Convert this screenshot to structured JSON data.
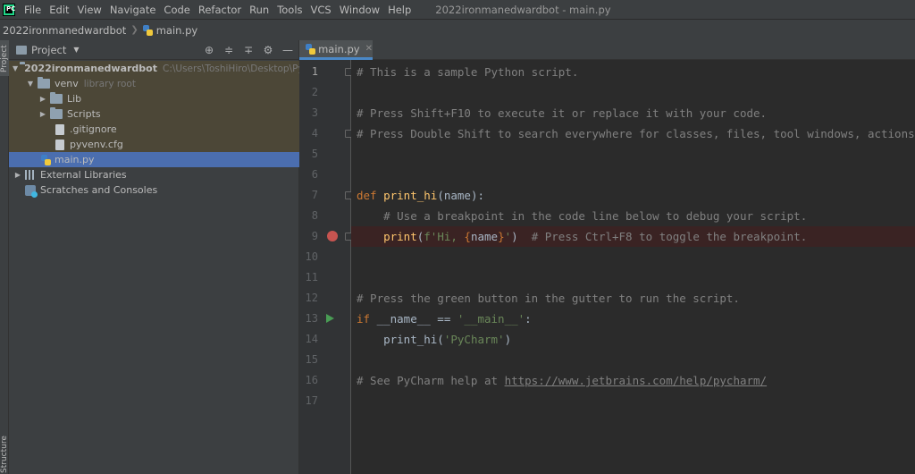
{
  "menubar": {
    "logo": "PC",
    "items": [
      "File",
      "Edit",
      "View",
      "Navigate",
      "Code",
      "Refactor",
      "Run",
      "Tools",
      "VCS",
      "Window",
      "Help"
    ],
    "window_title": "2022ironmanedwardbot - main.py"
  },
  "navbar": {
    "project": "2022ironmanedwardbot",
    "file": "main.py"
  },
  "toolstrip": {
    "project_tab": "Project",
    "structure_tab": "Structure"
  },
  "project_panel": {
    "title": "Project",
    "tools": [
      "crosshair-icon",
      "expand-all-icon",
      "collapse-all-icon",
      "gear-icon",
      "minimize-icon"
    ],
    "tree": [
      {
        "label": "2022ironmanedwardbot",
        "hint": "C:\\Users\\ToshiHiro\\Desktop\\Python",
        "icon": "folder",
        "expanded": true
      },
      {
        "label": "venv",
        "hint": "library root",
        "icon": "folder",
        "expanded": true
      },
      {
        "label": "Lib",
        "hint": "",
        "icon": "folder",
        "expanded": false
      },
      {
        "label": "Scripts",
        "hint": "",
        "icon": "folder",
        "expanded": false
      },
      {
        "label": ".gitignore",
        "hint": "",
        "icon": "file"
      },
      {
        "label": "pyvenv.cfg",
        "hint": "",
        "icon": "file"
      },
      {
        "label": "main.py",
        "hint": "",
        "icon": "python"
      },
      {
        "label": "External Libraries",
        "hint": "",
        "icon": "library",
        "expanded": false
      },
      {
        "label": "Scratches and Consoles",
        "hint": "",
        "icon": "scratch"
      }
    ]
  },
  "editor": {
    "tab_label": "main.py",
    "lines": [
      {
        "n": "1",
        "tokens": [
          [
            "c-comment",
            "# This is a sample Python script."
          ]
        ]
      },
      {
        "n": "2",
        "tokens": []
      },
      {
        "n": "3",
        "tokens": [
          [
            "c-comment",
            "# Press Shift+F10 to execute it or replace it with your code."
          ]
        ]
      },
      {
        "n": "4",
        "tokens": [
          [
            "c-comment",
            "# Press Double Shift to search everywhere for classes, files, tool windows, actions, and settings."
          ]
        ]
      },
      {
        "n": "5",
        "tokens": []
      },
      {
        "n": "6",
        "tokens": []
      },
      {
        "n": "7",
        "tokens": [
          [
            "c-kw",
            "def "
          ],
          [
            "c-fn",
            "print_hi"
          ],
          [
            "",
            "(name):"
          ]
        ]
      },
      {
        "n": "8",
        "tokens": [
          [
            "c-comment",
            "    # Use a breakpoint in the code line below to debug your script."
          ]
        ]
      },
      {
        "n": "9",
        "tokens": [
          [
            "c-fn",
            "    print"
          ],
          [
            "",
            "("
          ],
          [
            "c-str",
            "f'Hi, "
          ],
          [
            "c-kw",
            "{"
          ],
          [
            "",
            "name"
          ],
          [
            "c-kw",
            "}"
          ],
          [
            "c-str",
            "'"
          ],
          [
            "",
            ")  "
          ],
          [
            "c-comment",
            "# Press Ctrl+F8 to toggle the breakpoint."
          ]
        ]
      },
      {
        "n": "10",
        "tokens": []
      },
      {
        "n": "11",
        "tokens": []
      },
      {
        "n": "12",
        "tokens": [
          [
            "c-comment",
            "# Press the green button in the gutter to run the script."
          ]
        ]
      },
      {
        "n": "13",
        "tokens": [
          [
            "c-kw",
            "if "
          ],
          [
            "",
            "__name__ == "
          ],
          [
            "c-str",
            "'__main__'"
          ],
          [
            "",
            ":"
          ]
        ]
      },
      {
        "n": "14",
        "tokens": [
          [
            "",
            "    print_hi("
          ],
          [
            "c-str",
            "'PyCharm'"
          ],
          [
            "",
            ")"
          ]
        ]
      },
      {
        "n": "15",
        "tokens": []
      },
      {
        "n": "16",
        "tokens": [
          [
            "c-comment",
            "# See PyCharm help at "
          ],
          [
            "c-link",
            "https://www.jetbrains.com/help/pycharm/"
          ]
        ]
      },
      {
        "n": "17",
        "tokens": []
      }
    ],
    "breakpoint_line": "9",
    "run_line": "13"
  },
  "colors": {
    "bg": "#2b2b2b",
    "panel": "#3c3f41",
    "selection": "#4b6eaf",
    "comment": "#808080",
    "keyword": "#cc7832",
    "function": "#ffc66d",
    "string": "#6a8759"
  }
}
